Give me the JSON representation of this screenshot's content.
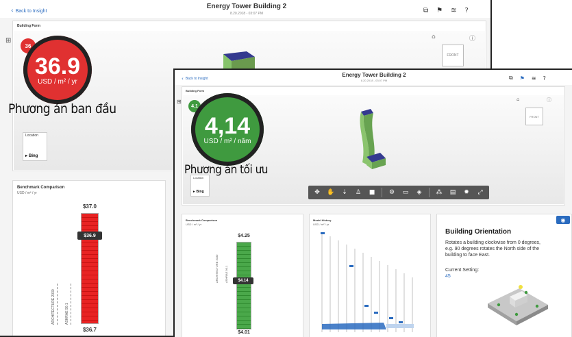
{
  "back_window": {
    "back_link": "Back to Insight",
    "title": "Energy Tower Building 2",
    "subtitle": "8.20.2018 - 03:07 PM",
    "panel_title": "Building Form",
    "small_badge": "36",
    "score_value": "36.9",
    "score_unit": "USD / m² / yr",
    "caption": "Phương án ban đầu",
    "location_label": "Location",
    "bing_label": "Bing",
    "benchmark_title": "Benchmark Comparison",
    "benchmark_unit": "USD / m² / yr",
    "bar_top": "$37.0",
    "bar_tag": "$36.9",
    "bar_bottom": "$36.7",
    "vlabel_a": "ARCHITECTURE 2030",
    "vlabel_b": "ASHRAE 90.1"
  },
  "front_window": {
    "back_link": "Back to Insight",
    "title": "Energy Tower Building 2",
    "subtitle": "8.20.2018 - 03:07 PM",
    "panel_title": "Building Form",
    "small_badge": "4.1",
    "score_value": "4,14",
    "score_unit": "USD / m² / năm",
    "caption": "Phương án tối ưu",
    "location_label": "Location",
    "bing_label": "Bing",
    "benchmark_title": "Benchmark Comparison",
    "benchmark_unit": "USD / m² / yr",
    "bar_top": "$4.25",
    "bar_tag": "$4.14",
    "bar_bottom": "$4.01",
    "vlabel_a": "ARCHITECTURE 2030",
    "vlabel_b": "ASHRAE 90.1",
    "model_history_title": "Model History",
    "model_history_unit": "USD / m² / yr",
    "orientation_title": "Building Orientation",
    "orientation_desc": "Rotates a building clockwise from 0 degrees, e.g. 90 degrees rotates the North side of the building to face East.",
    "current_setting_label": "Current Setting:",
    "current_setting_value": "45"
  },
  "colors": {
    "red": "#e03131",
    "green": "#3f9a3f",
    "link_blue": "#2a6bbf"
  }
}
